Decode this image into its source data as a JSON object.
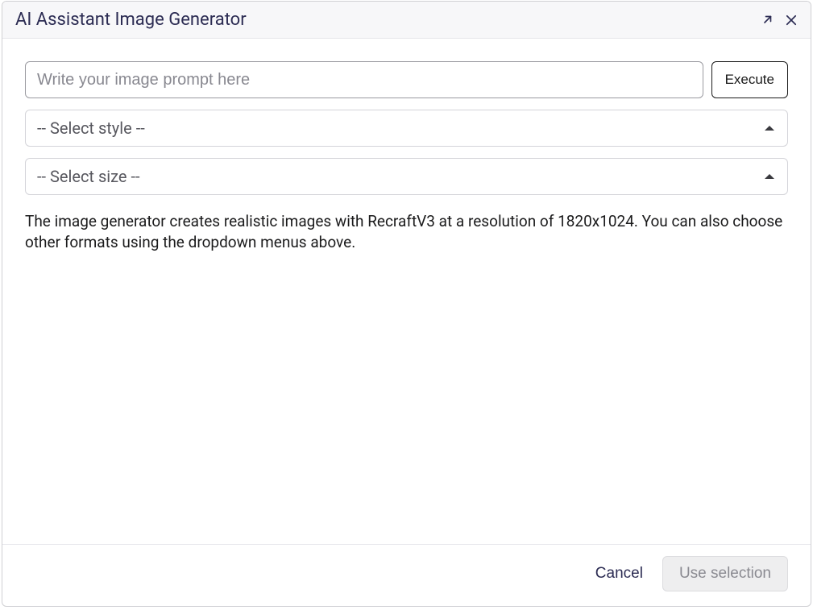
{
  "header": {
    "title": "AI Assistant Image Generator"
  },
  "prompt": {
    "placeholder": "Write your image prompt here",
    "value": "",
    "execute_label": "Execute"
  },
  "style_select": {
    "placeholder": "-- Select style --"
  },
  "size_select": {
    "placeholder": "-- Select size --"
  },
  "description": "The image generator creates realistic images with RecraftV3 at a resolution of 1820x1024. You can also choose other formats using the dropdown menus above.",
  "footer": {
    "cancel_label": "Cancel",
    "use_selection_label": "Use selection"
  }
}
